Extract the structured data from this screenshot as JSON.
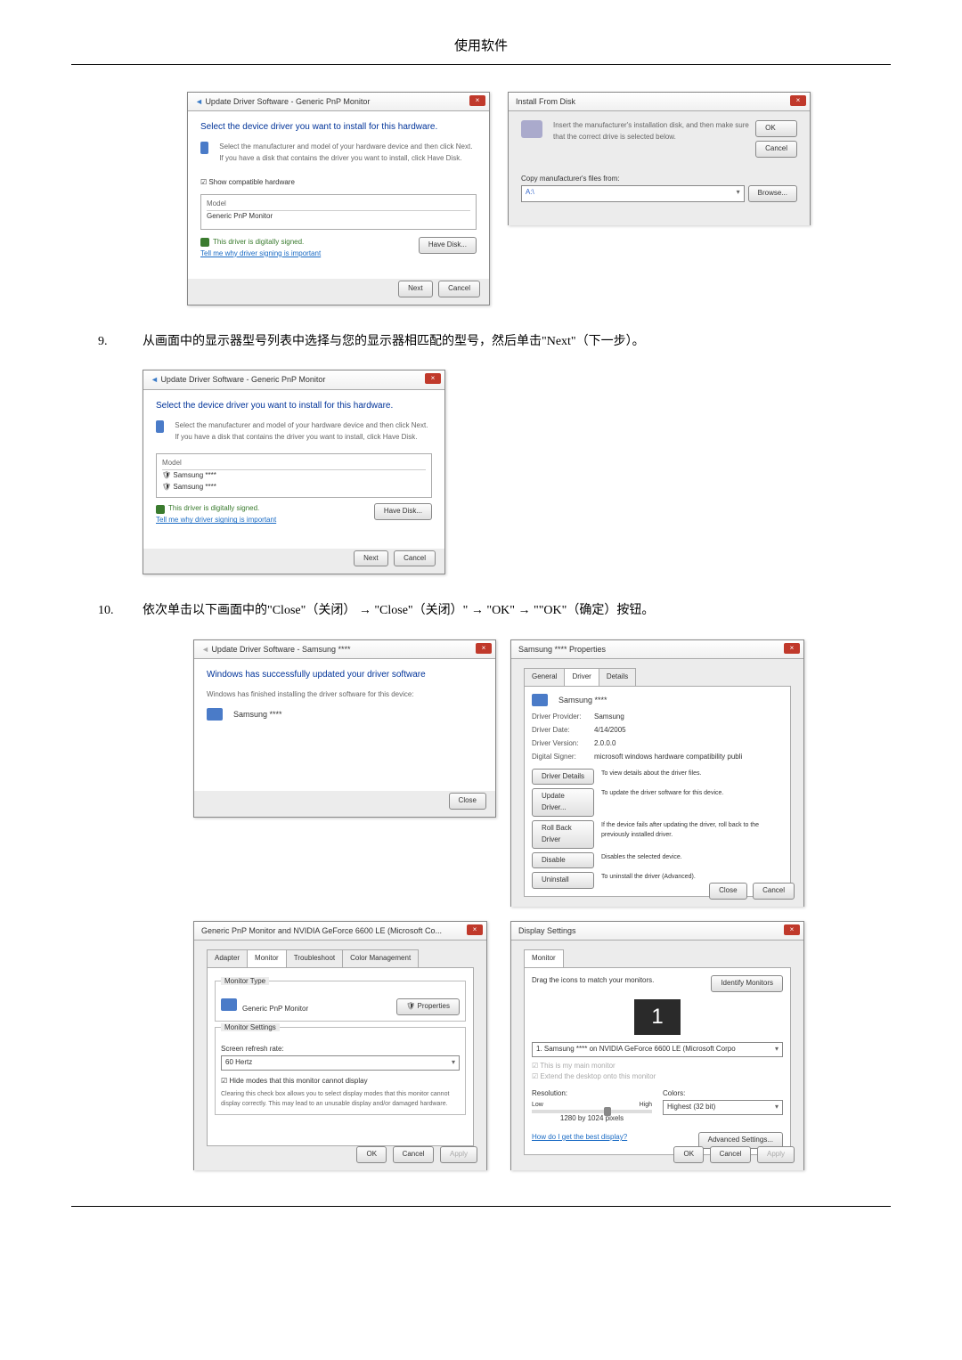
{
  "page_title": "使用软件",
  "step9": {
    "num": "9.",
    "text": "从画面中的显示器型号列表中选择与您的显示器相匹配的型号，然后单击\"Next\"（下一步）。"
  },
  "step10": {
    "num": "10.",
    "text": "依次单击以下画面中的\"Close\"（关闭）  →   \"Close\"（关闭）\"  →  \"OK\"  →  \"\"OK\"（确定）按钮。"
  },
  "dlg_update": {
    "title": "Update Driver Software - Generic PnP Monitor",
    "heading": "Select the device driver you want to install for this hardware.",
    "desc": "Select the manufacturer and model of your hardware device and then click Next. If you have a disk that contains the driver you want to install, click Have Disk.",
    "show_compat": "Show compatible hardware",
    "model_hdr": "Model",
    "model_item": "Generic PnP Monitor",
    "signed": "This driver is digitally signed.",
    "tell_me": "Tell me why driver signing is important",
    "have_disk": "Have Disk...",
    "next": "Next",
    "cancel": "Cancel"
  },
  "dlg_disk": {
    "title": "Install From Disk",
    "msg": "Insert the manufacturer's installation disk, and then make sure that the correct drive is selected below.",
    "copy_from": "Copy manufacturer's files from:",
    "ok": "OK",
    "cancel": "Cancel",
    "browse": "Browse..."
  },
  "dlg_update2": {
    "title": "Update Driver Software - Generic PnP Monitor",
    "heading": "Select the device driver you want to install for this hardware.",
    "desc": "Select the manufacturer and model of your hardware device and then click Next. If you have a disk that contains the driver you want to install, click Have Disk.",
    "model_hdr": "Model",
    "item1": "Samsung ****",
    "item2": "Samsung ****",
    "signed": "This driver is digitally signed.",
    "tell_me": "Tell me why driver signing is important",
    "have_disk": "Have Disk...",
    "next": "Next",
    "cancel": "Cancel"
  },
  "dlg_success": {
    "title": "Update Driver Software - Samsung ****",
    "heading": "Windows has successfully updated your driver software",
    "desc": "Windows has finished installing the driver software for this device:",
    "device": "Samsung ****",
    "close": "Close"
  },
  "dlg_props": {
    "title": "Samsung **** Properties",
    "tab_general": "General",
    "tab_driver": "Driver",
    "tab_details": "Details",
    "device": "Samsung ****",
    "provider_lbl": "Driver Provider:",
    "provider": "Samsung",
    "date_lbl": "Driver Date:",
    "date": "4/14/2005",
    "version_lbl": "Driver Version:",
    "version": "2.0.0.0",
    "signer_lbl": "Digital Signer:",
    "signer": "microsoft windows hardware compatibility publi",
    "btn_details": "Driver Details",
    "btn_details_desc": "To view details about the driver files.",
    "btn_update": "Update Driver...",
    "btn_update_desc": "To update the driver software for this device.",
    "btn_rollback": "Roll Back Driver",
    "btn_rollback_desc": "If the device fails after updating the driver, roll back to the previously installed driver.",
    "btn_disable": "Disable",
    "btn_disable_desc": "Disables the selected device.",
    "btn_uninstall": "Uninstall",
    "btn_uninstall_desc": "To uninstall the driver (Advanced).",
    "close": "Close",
    "cancel": "Cancel"
  },
  "dlg_monitor": {
    "title": "Generic PnP Monitor and NVIDIA GeForce 6600 LE (Microsoft Co...",
    "tab_adapter": "Adapter",
    "tab_monitor": "Monitor",
    "tab_trouble": "Troubleshoot",
    "tab_color": "Color Management",
    "type_lbl": "Monitor Type",
    "type": "Generic PnP Monitor",
    "properties": "Properties",
    "settings_lbl": "Monitor Settings",
    "refresh_lbl": "Screen refresh rate:",
    "refresh": "60 Hertz",
    "hide_cb": "Hide modes that this monitor cannot display",
    "hide_desc": "Clearing this check box allows you to select display modes that this monitor cannot display correctly. This may lead to an unusable display and/or damaged hardware.",
    "ok": "OK",
    "cancel": "Cancel",
    "apply": "Apply"
  },
  "dlg_display": {
    "title": "Display Settings",
    "tab_monitor": "Monitor",
    "drag": "Drag the icons to match your monitors.",
    "identify": "Identify Monitors",
    "preview": "1",
    "monitor_sel": "1. Samsung **** on NVIDIA GeForce 6600 LE (Microsoft Corpo",
    "main_cb": "This is my main monitor",
    "extend_cb": "Extend the desktop onto this monitor",
    "res_lbl": "Resolution:",
    "low": "Low",
    "high": "High",
    "res_val": "1280 by 1024 pixels",
    "colors_lbl": "Colors:",
    "colors": "Highest (32 bit)",
    "how_link": "How do I get the best display?",
    "advanced": "Advanced Settings...",
    "ok": "OK",
    "cancel": "Cancel",
    "apply": "Apply"
  }
}
